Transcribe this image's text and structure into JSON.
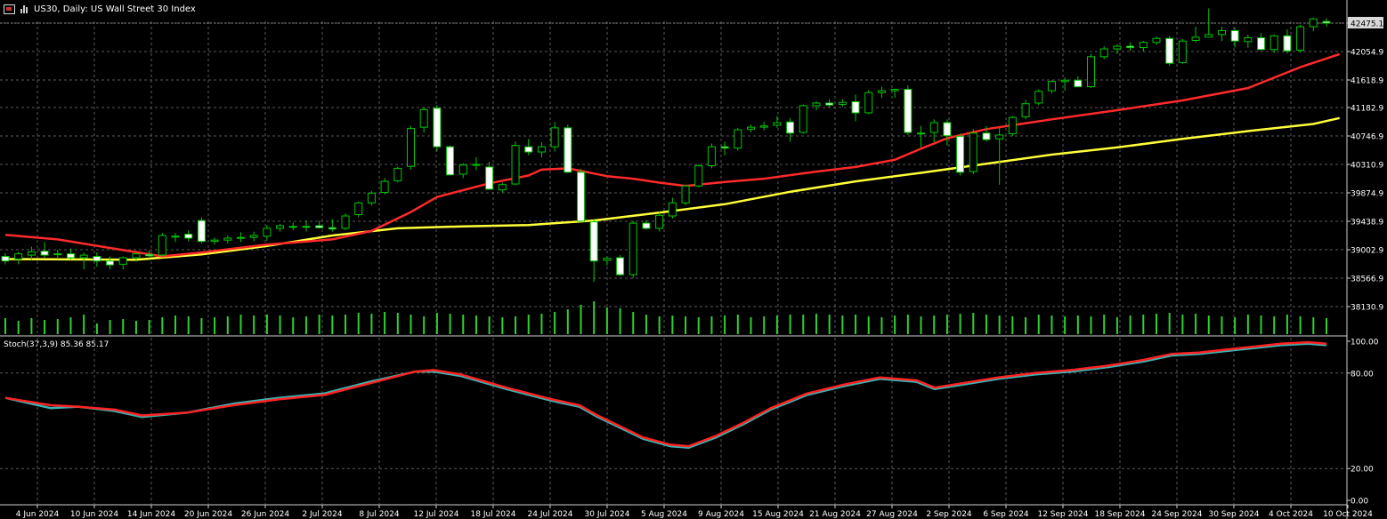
{
  "header": {
    "title": "US30, Daily:  US Wall Street 30 Index",
    "icon1": "chart-window-icon",
    "icon2": "bar-chart-icon"
  },
  "colors": {
    "bull": "#00c800",
    "bear_body": "#ffffff",
    "ma_fast": "#ff2a2a",
    "ma_slow": "#ffff3a",
    "volume": "#2fd12f",
    "stoch_main": "#3ab3b3",
    "stoch_signal": "#ff2222",
    "grid": "#5a5a5a"
  },
  "main_axis": {
    "ticks": [
      "42475.1",
      "42054.9",
      "41618.9",
      "41182.9",
      "40746.9",
      "40310.9",
      "39874.9",
      "39438.9",
      "39002.9",
      "38566.9",
      "38130.9"
    ],
    "current": "42475.1"
  },
  "stoch": {
    "label": "Stoch(37,3,9) 85.36 85.17",
    "ticks": [
      "100.00",
      "80.00",
      "20.00",
      "0.00"
    ]
  },
  "x_labels": [
    "4 Jun 2024",
    "10 Jun 2024",
    "14 Jun 2024",
    "20 Jun 2024",
    "26 Jun 2024",
    "2 Jul 2024",
    "8 Jul 2024",
    "12 Jul 2024",
    "18 Jul 2024",
    "24 Jul 2024",
    "30 Jul 2024",
    "5 Aug 2024",
    "9 Aug 2024",
    "15 Aug 2024",
    "21 Aug 2024",
    "27 Aug 2024",
    "2 Sep 2024",
    "6 Sep 2024",
    "12 Sep 2024",
    "18 Sep 2024",
    "24 Sep 2024",
    "30 Sep 2024",
    "4 Oct 2024",
    "10 Oct 2024"
  ],
  "chart_data": {
    "type": "candlestick",
    "title": "US30, Daily:  US Wall Street 30 Index",
    "ylim": [
      38000,
      42700
    ],
    "candles": [
      [
        38900,
        38950,
        38780,
        38830
      ],
      [
        38860,
        38970,
        38780,
        38940
      ],
      [
        38920,
        39050,
        38850,
        38970
      ],
      [
        38980,
        39120,
        38880,
        38920
      ],
      [
        38930,
        39000,
        38860,
        38940
      ],
      [
        38940,
        39020,
        38850,
        38880
      ],
      [
        38880,
        38960,
        38700,
        38920
      ],
      [
        38900,
        38960,
        38740,
        38830
      ],
      [
        38830,
        38900,
        38700,
        38770
      ],
      [
        38780,
        38900,
        38700,
        38880
      ],
      [
        38880,
        38960,
        38820,
        38940
      ],
      [
        38930,
        38990,
        38870,
        38910
      ],
      [
        38920,
        39260,
        38900,
        39220
      ],
      [
        39200,
        39260,
        39120,
        39210
      ],
      [
        39240,
        39300,
        39130,
        39180
      ],
      [
        39450,
        39500,
        39100,
        39130
      ],
      [
        39130,
        39190,
        39080,
        39150
      ],
      [
        39150,
        39220,
        39100,
        39180
      ],
      [
        39180,
        39270,
        39120,
        39190
      ],
      [
        39190,
        39280,
        39130,
        39220
      ],
      [
        39210,
        39380,
        39140,
        39330
      ],
      [
        39330,
        39400,
        39280,
        39370
      ],
      [
        39360,
        39420,
        39300,
        39350
      ],
      [
        39350,
        39450,
        39280,
        39360
      ],
      [
        39370,
        39450,
        39330,
        39340
      ],
      [
        39340,
        39470,
        39280,
        39320
      ],
      [
        39330,
        39560,
        39300,
        39520
      ],
      [
        39540,
        39740,
        39500,
        39720
      ],
      [
        39720,
        39900,
        39680,
        39870
      ],
      [
        39880,
        40100,
        39850,
        40050
      ],
      [
        40060,
        40270,
        40030,
        40250
      ],
      [
        40280,
        40900,
        40230,
        40860
      ],
      [
        40880,
        41190,
        40800,
        41150
      ],
      [
        41170,
        41220,
        40510,
        40580
      ],
      [
        40580,
        40600,
        40140,
        40150
      ],
      [
        40160,
        40330,
        40100,
        40300
      ],
      [
        40300,
        40420,
        40220,
        40310
      ],
      [
        40270,
        40350,
        39920,
        39930
      ],
      [
        39920,
        40030,
        39880,
        40000
      ],
      [
        40010,
        40660,
        39990,
        40600
      ],
      [
        40580,
        40700,
        40450,
        40500
      ],
      [
        40500,
        40650,
        40420,
        40580
      ],
      [
        40580,
        40960,
        40510,
        40870
      ],
      [
        40870,
        40920,
        40180,
        40190
      ],
      [
        40190,
        40240,
        39430,
        39440
      ],
      [
        39430,
        39480,
        38510,
        38830
      ],
      [
        38840,
        38900,
        38760,
        38870
      ],
      [
        38880,
        38920,
        38600,
        38620
      ],
      [
        38620,
        39440,
        38570,
        39410
      ],
      [
        39410,
        39460,
        39310,
        39330
      ],
      [
        39330,
        39580,
        39280,
        39530
      ],
      [
        39520,
        39800,
        39480,
        39720
      ],
      [
        39720,
        40000,
        39680,
        39980
      ],
      [
        39980,
        40310,
        39960,
        40290
      ],
      [
        40290,
        40630,
        40250,
        40580
      ],
      [
        40580,
        40660,
        40450,
        40560
      ],
      [
        40560,
        40870,
        40520,
        40840
      ],
      [
        40850,
        40920,
        40800,
        40880
      ],
      [
        40880,
        40960,
        40830,
        40900
      ],
      [
        40910,
        41050,
        40870,
        40950
      ],
      [
        40960,
        41020,
        40660,
        40790
      ],
      [
        40800,
        41230,
        40780,
        41210
      ],
      [
        41210,
        41280,
        41140,
        41250
      ],
      [
        41250,
        41310,
        41190,
        41220
      ],
      [
        41230,
        41310,
        41190,
        41260
      ],
      [
        41270,
        41380,
        40970,
        41100
      ],
      [
        41100,
        41450,
        41080,
        41410
      ],
      [
        41410,
        41500,
        41330,
        41440
      ],
      [
        41440,
        41470,
        41330,
        41460
      ],
      [
        41460,
        41520,
        40760,
        40800
      ],
      [
        40790,
        40900,
        40570,
        40790
      ],
      [
        40800,
        41000,
        40650,
        40950
      ],
      [
        40950,
        41000,
        40600,
        40750
      ],
      [
        40740,
        40780,
        40140,
        40190
      ],
      [
        40200,
        40850,
        40160,
        40790
      ],
      [
        40790,
        40900,
        40660,
        40690
      ],
      [
        40700,
        40870,
        40000,
        40760
      ],
      [
        40780,
        41050,
        40740,
        41030
      ],
      [
        41040,
        41300,
        41000,
        41240
      ],
      [
        41250,
        41460,
        41220,
        41430
      ],
      [
        41440,
        41600,
        41400,
        41580
      ],
      [
        41580,
        41640,
        41440,
        41600
      ],
      [
        41600,
        41660,
        41490,
        41500
      ],
      [
        41500,
        42000,
        41480,
        41960
      ],
      [
        41960,
        42120,
        41920,
        42080
      ],
      [
        42080,
        42150,
        42000,
        42120
      ],
      [
        42120,
        42180,
        42050,
        42100
      ],
      [
        42100,
        42200,
        42040,
        42180
      ],
      [
        42180,
        42270,
        42140,
        42240
      ],
      [
        42240,
        42280,
        41820,
        41860
      ],
      [
        41870,
        42230,
        41850,
        42200
      ],
      [
        42210,
        42420,
        42180,
        42260
      ],
      [
        42260,
        42700,
        42260,
        42300
      ],
      [
        42300,
        42420,
        42200,
        42360
      ],
      [
        42360,
        42400,
        42100,
        42200
      ],
      [
        42190,
        42300,
        42100,
        42250
      ],
      [
        42250,
        42320,
        42060,
        42070
      ],
      [
        42070,
        42300,
        42020,
        42280
      ],
      [
        42280,
        42380,
        42010,
        42050
      ],
      [
        42060,
        42450,
        42020,
        42420
      ],
      [
        42420,
        42560,
        42350,
        42540
      ],
      [
        42500,
        42550,
        42420,
        42475
      ]
    ],
    "ma_fast": [
      [
        0,
        39230
      ],
      [
        4,
        39160
      ],
      [
        8,
        39030
      ],
      [
        12,
        38900
      ],
      [
        15,
        38960
      ],
      [
        20,
        39080
      ],
      [
        25,
        39160
      ],
      [
        28,
        39290
      ],
      [
        31,
        39580
      ],
      [
        33,
        39810
      ],
      [
        37,
        40020
      ],
      [
        40,
        40140
      ],
      [
        41,
        40230
      ],
      [
        43,
        40250
      ],
      [
        46,
        40130
      ],
      [
        48,
        40090
      ],
      [
        50,
        40030
      ],
      [
        52,
        39980
      ],
      [
        55,
        40040
      ],
      [
        58,
        40090
      ],
      [
        62,
        40200
      ],
      [
        65,
        40270
      ],
      [
        68,
        40380
      ],
      [
        70,
        40550
      ],
      [
        72,
        40710
      ],
      [
        75,
        40850
      ],
      [
        80,
        41000
      ],
      [
        85,
        41140
      ],
      [
        90,
        41290
      ],
      [
        95,
        41480
      ],
      [
        99,
        41800
      ],
      [
        102,
        42000
      ]
    ],
    "ma_slow": [
      [
        0,
        38860
      ],
      [
        10,
        38850
      ],
      [
        15,
        38930
      ],
      [
        20,
        39060
      ],
      [
        25,
        39220
      ],
      [
        30,
        39330
      ],
      [
        35,
        39360
      ],
      [
        40,
        39380
      ],
      [
        45,
        39450
      ],
      [
        50,
        39570
      ],
      [
        55,
        39700
      ],
      [
        60,
        39890
      ],
      [
        65,
        40050
      ],
      [
        70,
        40180
      ],
      [
        75,
        40320
      ],
      [
        80,
        40460
      ],
      [
        85,
        40570
      ],
      [
        90,
        40700
      ],
      [
        95,
        40820
      ],
      [
        100,
        40930
      ],
      [
        102,
        41020
      ]
    ],
    "volume": [
      18,
      15,
      18,
      16,
      17,
      19,
      22,
      12,
      16,
      17,
      15,
      16,
      19,
      21,
      20,
      18,
      19,
      20,
      22,
      21,
      22,
      21,
      19,
      20,
      22,
      21,
      22,
      24,
      23,
      25,
      24,
      22,
      20,
      24,
      23,
      22,
      21,
      20,
      19,
      20,
      22,
      23,
      25,
      28,
      33,
      37,
      30,
      29,
      25,
      22,
      20,
      21,
      20,
      19,
      20,
      21,
      22,
      19,
      20,
      21,
      22,
      22,
      23,
      22,
      21,
      22,
      20,
      19,
      21,
      22,
      20,
      21,
      22,
      23,
      24,
      22,
      21,
      20,
      19,
      22,
      21,
      20,
      21,
      20,
      22,
      19,
      21,
      22,
      23,
      24,
      22,
      23,
      21,
      20,
      19,
      22,
      21,
      20,
      22,
      20,
      19,
      18
    ],
    "stoch_main": [
      [
        0,
        70
      ],
      [
        5,
        63
      ],
      [
        8,
        64
      ],
      [
        12,
        61
      ],
      [
        15,
        57
      ],
      [
        20,
        60
      ],
      [
        25,
        66
      ],
      [
        30,
        70
      ],
      [
        35,
        73
      ],
      [
        40,
        81
      ],
      [
        45,
        88
      ],
      [
        47,
        88
      ],
      [
        50,
        85
      ],
      [
        55,
        76
      ],
      [
        60,
        68
      ],
      [
        63,
        64
      ],
      [
        65,
        57
      ],
      [
        70,
        42
      ],
      [
        73,
        37
      ],
      [
        75,
        36
      ],
      [
        78,
        43
      ],
      [
        81,
        52
      ],
      [
        84,
        62
      ],
      [
        88,
        72
      ],
      [
        92,
        78
      ],
      [
        96,
        83
      ],
      [
        100,
        81
      ],
      [
        102,
        76
      ],
      [
        105,
        79
      ],
      [
        109,
        83
      ],
      [
        113,
        86
      ],
      [
        117,
        88
      ],
      [
        121,
        91
      ],
      [
        125,
        95
      ],
      [
        128,
        99
      ],
      [
        131,
        100
      ],
      [
        134,
        102
      ],
      [
        137,
        104
      ],
      [
        140,
        106
      ],
      [
        143,
        107
      ],
      [
        145,
        106
      ]
    ],
    "stoch_signal": [
      [
        0,
        70
      ],
      [
        5,
        65
      ],
      [
        8,
        64
      ],
      [
        12,
        62
      ],
      [
        15,
        58
      ],
      [
        20,
        60
      ],
      [
        25,
        65
      ],
      [
        30,
        69
      ],
      [
        35,
        72
      ],
      [
        40,
        80
      ],
      [
        45,
        88
      ],
      [
        47,
        89
      ],
      [
        50,
        86
      ],
      [
        55,
        77
      ],
      [
        60,
        69
      ],
      [
        63,
        65
      ],
      [
        65,
        58
      ],
      [
        70,
        43
      ],
      [
        73,
        38
      ],
      [
        75,
        37
      ],
      [
        78,
        44
      ],
      [
        81,
        53
      ],
      [
        84,
        63
      ],
      [
        88,
        73
      ],
      [
        92,
        79
      ],
      [
        96,
        84
      ],
      [
        100,
        82
      ],
      [
        102,
        77
      ],
      [
        105,
        80
      ],
      [
        109,
        84
      ],
      [
        113,
        87
      ],
      [
        117,
        89
      ],
      [
        121,
        92
      ],
      [
        125,
        96
      ],
      [
        128,
        100
      ],
      [
        131,
        101
      ],
      [
        134,
        103
      ],
      [
        137,
        105
      ],
      [
        140,
        107
      ],
      [
        143,
        108
      ],
      [
        145,
        107
      ]
    ]
  }
}
